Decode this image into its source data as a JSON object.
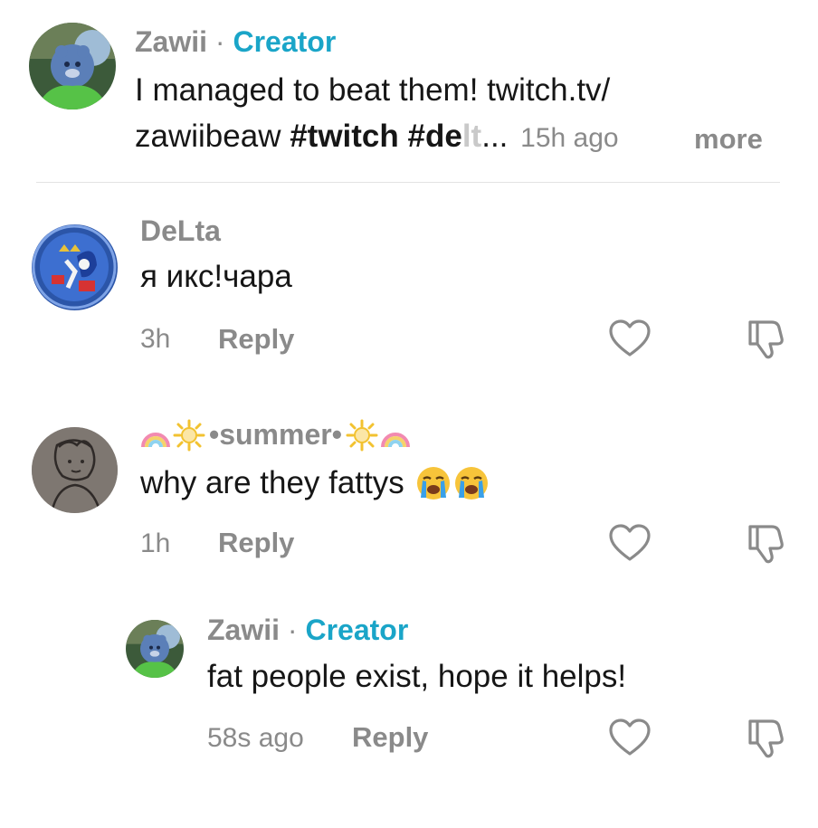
{
  "icons": {
    "like": "heart-outline-icon",
    "dislike": "thumbs-down-outline-icon",
    "rainbow": "rainbow-emoji",
    "sun": "sun-emoji",
    "crying": "loudly-crying-face-emoji"
  },
  "colors": {
    "creator_badge": "#1aa5c8",
    "meta_gray": "#8a8a8a",
    "text": "#161616",
    "divider": "#e3e3e3"
  },
  "caption": {
    "author": "Zawii",
    "separator": "·",
    "badge": "Creator",
    "text_line1": "I managed to beat them! twitch.tv/",
    "text_line2_plain": "zawiibeaw ",
    "hashtag_twitch": "#twitch",
    "hashtag_partial_visible": "#de",
    "hashtag_partial_faded": "lt",
    "ellipsis": "...",
    "time": "15h ago",
    "more_label": "more"
  },
  "comments": [
    {
      "author": "DeLta",
      "text": "я икс!чара",
      "time": "3h",
      "reply_label": "Reply"
    },
    {
      "author": "•summer•",
      "text": "why are they fattys",
      "time": "1h",
      "reply_label": "Reply",
      "reply": {
        "author": "Zawii",
        "separator": "·",
        "badge": "Creator",
        "text": "fat people exist, hope it helps!",
        "time": "58s ago",
        "reply_label": "Reply"
      }
    }
  ]
}
